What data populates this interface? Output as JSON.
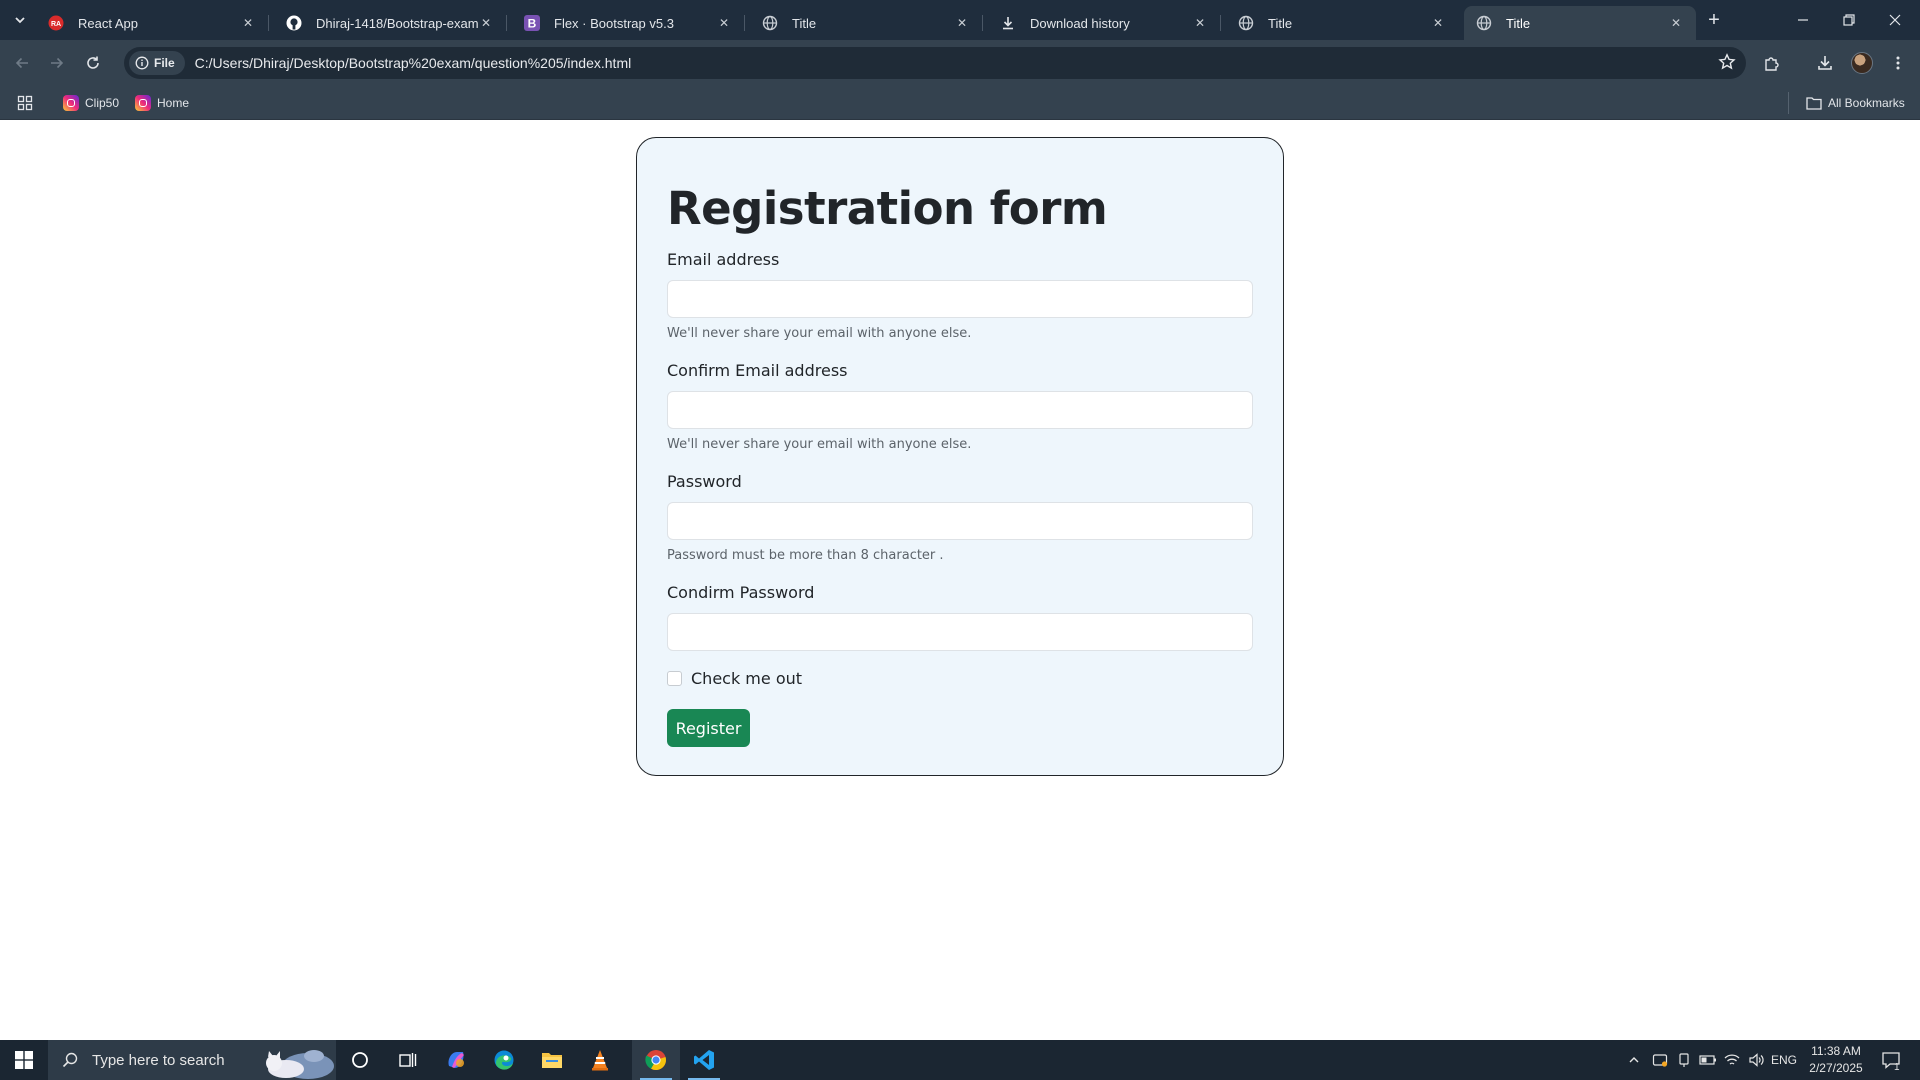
{
  "browser": {
    "tabs": [
      {
        "title": "React App",
        "icon": "react-app-icon"
      },
      {
        "title": "Dhiraj-1418/Bootstrap-exam",
        "icon": "github-icon"
      },
      {
        "title": "Flex · Bootstrap v5.3",
        "icon": "bootstrap-icon"
      },
      {
        "title": "Title",
        "icon": "globe-icon"
      },
      {
        "title": "Download history",
        "icon": "download-icon"
      },
      {
        "title": "Title",
        "icon": "globe-icon"
      },
      {
        "title": "Title",
        "icon": "globe-icon",
        "active": true
      }
    ],
    "address": {
      "scheme_chip": "File",
      "url": "C:/Users/Dhiraj/Desktop/Bootstrap%20exam/question%205/index.html"
    },
    "bookmarks": [
      {
        "label": "Clip50",
        "icon": "instagram-icon"
      },
      {
        "label": "Home",
        "icon": "instagram-icon"
      }
    ],
    "all_bookmarks_label": "All Bookmarks"
  },
  "form": {
    "title": "Registration form",
    "email_label": "Email address",
    "email_value": "",
    "email_help": "We'll never share your email with anyone else.",
    "confirm_email_label": "Confirm Email address",
    "confirm_email_value": "",
    "confirm_email_help": "We'll never share your email with anyone else.",
    "password_label": "Password",
    "password_value": "",
    "password_help": "Password must be more than 8 character .",
    "confirm_password_label": "Condirm Password",
    "confirm_password_value": "",
    "checkbox_label": "Check me out",
    "checkbox_checked": false,
    "submit_label": "Register",
    "colors": {
      "card_bg": "#eef6fc",
      "button": "#198754",
      "border": "#212529"
    }
  },
  "taskbar": {
    "search_placeholder": "Type here to search",
    "language": "ENG",
    "time": "11:38 AM",
    "date": "2/27/2025",
    "notification_count": "1"
  }
}
